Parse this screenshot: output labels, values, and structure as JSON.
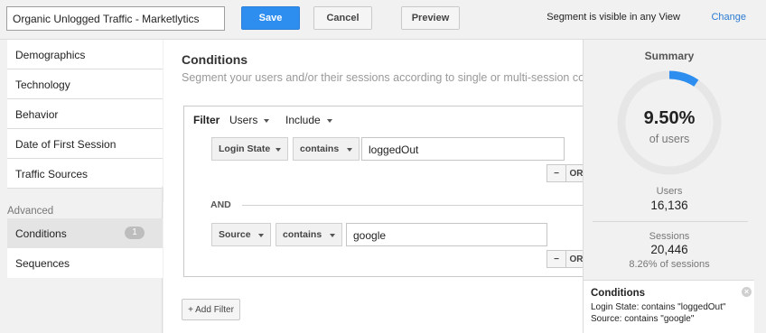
{
  "topbar": {
    "segment_name": "Organic Unlogged Traffic - Marketlytics",
    "save_label": "Save",
    "cancel_label": "Cancel",
    "preview_label": "Preview",
    "visibility_text": "Segment is visible in any View",
    "change_label": "Change"
  },
  "sidebar": {
    "items": [
      {
        "label": "Demographics"
      },
      {
        "label": "Technology"
      },
      {
        "label": "Behavior"
      },
      {
        "label": "Date of First Session"
      },
      {
        "label": "Traffic Sources"
      }
    ],
    "advanced_heading": "Advanced",
    "advanced_items": [
      {
        "label": "Conditions",
        "badge": "1"
      },
      {
        "label": "Sequences"
      }
    ]
  },
  "conditions": {
    "title": "Conditions",
    "subtitle": "Segment your users and/or their sessions according to single or multi-session conditions.",
    "filter_label": "Filter",
    "scope": "Users",
    "mode": "Include",
    "rows": [
      {
        "dimension": "Login State",
        "operator": "contains",
        "value": "loggedOut",
        "remove": "−",
        "or": "OR"
      },
      {
        "dimension": "Source",
        "operator": "contains",
        "value": "google",
        "remove": "−",
        "or": "OR"
      }
    ],
    "and_label": "AND",
    "add_filter_label": "+ Add Filter"
  },
  "summary": {
    "title": "Summary",
    "percent_text": "9.50%",
    "percent_value": 9.5,
    "of_label": "of users",
    "users_label": "Users",
    "users_value": "16,136",
    "sessions_label": "Sessions",
    "sessions_value": "20,446",
    "sessions_sub": "8.26% of sessions",
    "card_title": "Conditions",
    "card_lines": [
      "Login State: contains \"loggedOut\"",
      "Source: contains \"google\""
    ],
    "colors": {
      "donut_fill": "#2d8ef0",
      "donut_track": "#e6e6e6"
    }
  }
}
